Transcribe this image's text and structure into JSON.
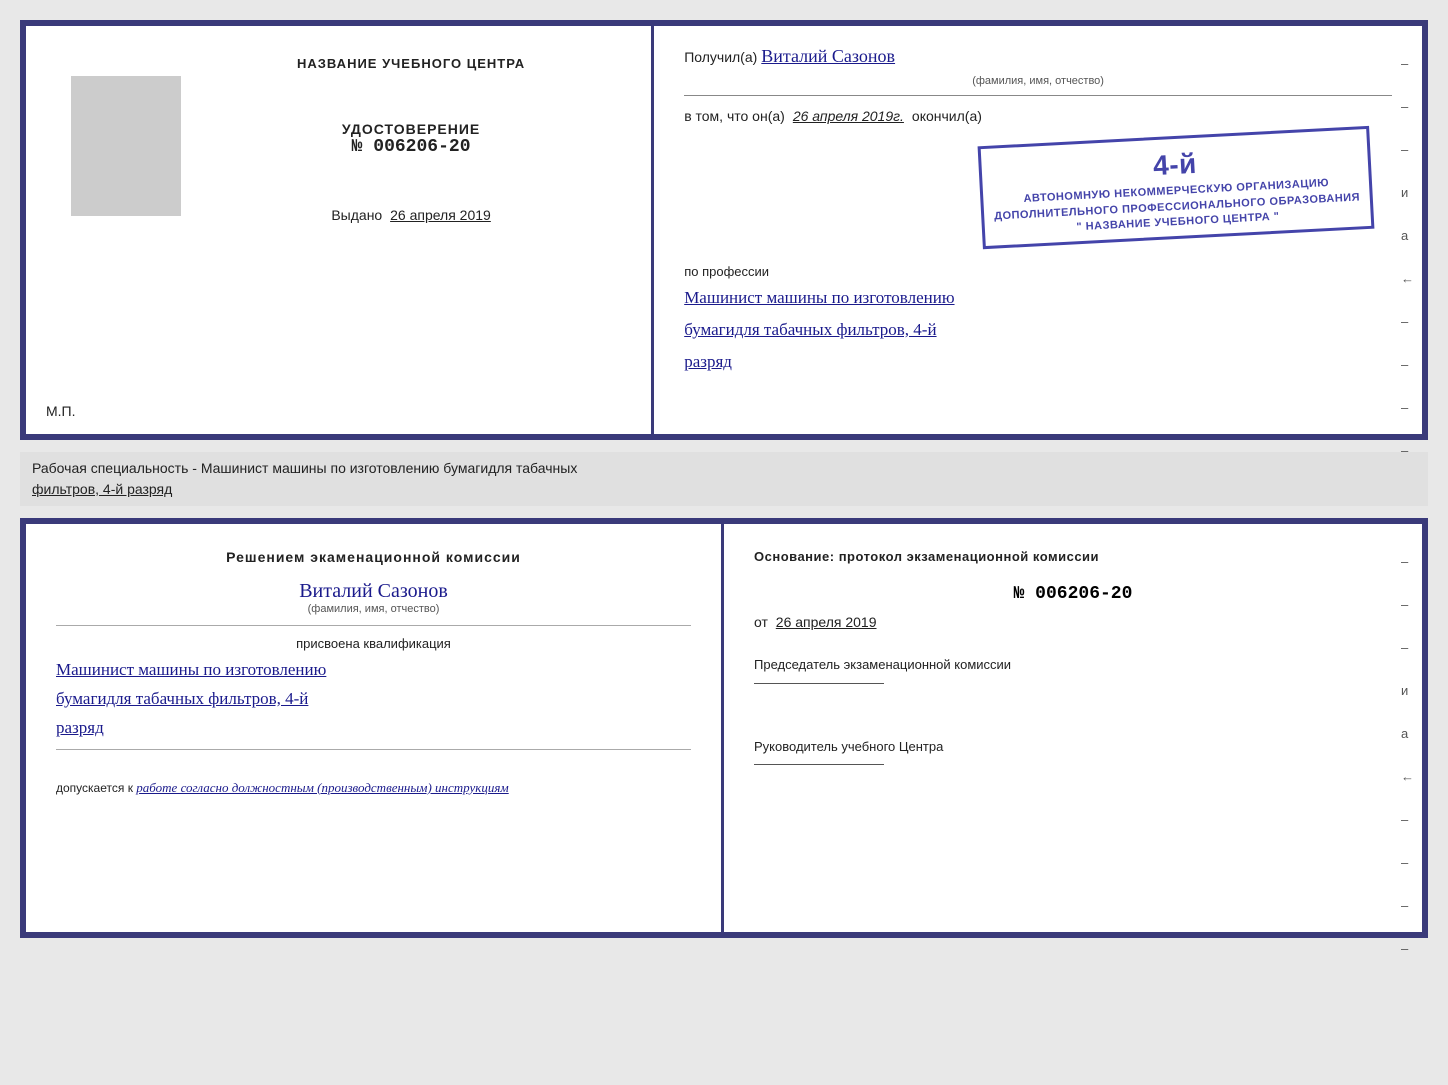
{
  "topCert": {
    "left": {
      "title": "НАЗВАНИЕ УЧЕБНОГО ЦЕНТРА",
      "certLabel": "УДОСТОВЕРЕНИЕ",
      "certNumber": "№ 006206-20",
      "issuedLabel": "Выдано",
      "issuedDate": "26 апреля 2019",
      "mpLabel": "М.П."
    },
    "right": {
      "receivedLabel": "Получил(а)",
      "recipientName": "Виталий Сазонов",
      "nameSubtitle": "(фамилия, имя, отчество)",
      "inThatLabel": "в том, что он(а)",
      "dateLabel": "26 апреля 2019г.",
      "completedLabel": "окончил(а)",
      "stampLine1": "4-й",
      "orgLine1": "АВТОНОМНУЮ НЕКОММЕРЧЕСКУЮ ОРГАНИЗАЦИЮ",
      "orgLine2": "ДОПОЛНИТЕЛЬНОГО ПРОФЕССИОНАЛЬНОГО ОБРАЗОВАНИЯ",
      "orgLine3": "\" НАЗВАНИЕ УЧЕБНОГО ЦЕНТРА \"",
      "professionLabel": "по профессии",
      "professionLine1": "Машинист машины по изготовлению",
      "professionLine2": "бумагидля табачных фильтров, 4-й",
      "professionLine3": "разряд",
      "dashes": [
        "-",
        "-",
        "-",
        "и",
        "а",
        "←",
        "-",
        "-",
        "-",
        "-"
      ]
    }
  },
  "descriptionBar": {
    "text": "Рабочая специальность - Машинист машины по изготовлению бумагидля табачных",
    "underlinedText": "фильтров, 4-й разряд"
  },
  "bottomCert": {
    "left": {
      "commissionTitle": "Решением экаменационной комиссии",
      "personName": "Виталий Сазонов",
      "nameSubtitle": "(фамилия, имя, отчество)",
      "qualLabel": "присвоена квалификация",
      "qualLine1": "Машинист машины по изготовлению",
      "qualLine2": "бумагидля табачных фильтров, 4-й",
      "qualLine3": "разряд",
      "допускLabel": "допускается к",
      "допускText": "работе согласно должностным (производственным) инструкциям"
    },
    "right": {
      "basisLabel": "Основание: протокол экзаменационной комиссии",
      "protocolNumber": "№ 006206-20",
      "fromLabel": "от",
      "fromDate": "26 апреля 2019",
      "chairmanLabel": "Председатель экзаменационной комиссии",
      "headLabel": "Руководитель учебного Центра",
      "dashes": [
        "-",
        "-",
        "-",
        "и",
        "а",
        "←",
        "-",
        "-",
        "-",
        "-"
      ]
    }
  }
}
